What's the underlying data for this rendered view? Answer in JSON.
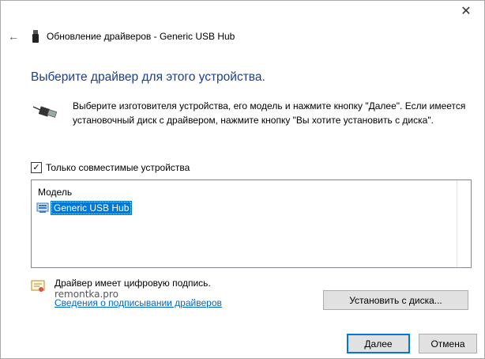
{
  "window": {
    "title": "Обновление драйверов - Generic USB Hub",
    "close_glyph": "✕",
    "back_glyph": "←"
  },
  "heading": "Выберите драйвер для этого устройства.",
  "instructions": "Выберите изготовителя устройства, его модель и нажмите кнопку \"Далее\". Если имеется установочный диск с  драйвером, нажмите кнопку \"Вы хотите установить с диска\".",
  "compatible": {
    "label": "Только совместимые устройства",
    "checked": true
  },
  "model_list": {
    "header": "Модель",
    "items": [
      "Generic USB Hub"
    ],
    "selected_index": 0
  },
  "signature": {
    "text": "Драйвер имеет цифровую подпись.",
    "link": "Сведения о подписывании драйверов"
  },
  "watermark": "remontka.pro",
  "buttons": {
    "install_from_disk": "Установить с диска...",
    "next": "Далее",
    "cancel": "Отмена"
  },
  "colors": {
    "heading": "#1a3f8c",
    "selection": "#0078d7",
    "link": "#0066cc"
  },
  "icons": {
    "title": "usb-device-icon",
    "instructions": "usb-cable-icon",
    "list_item": "hardware-device-icon",
    "signature": "certificate-icon"
  }
}
